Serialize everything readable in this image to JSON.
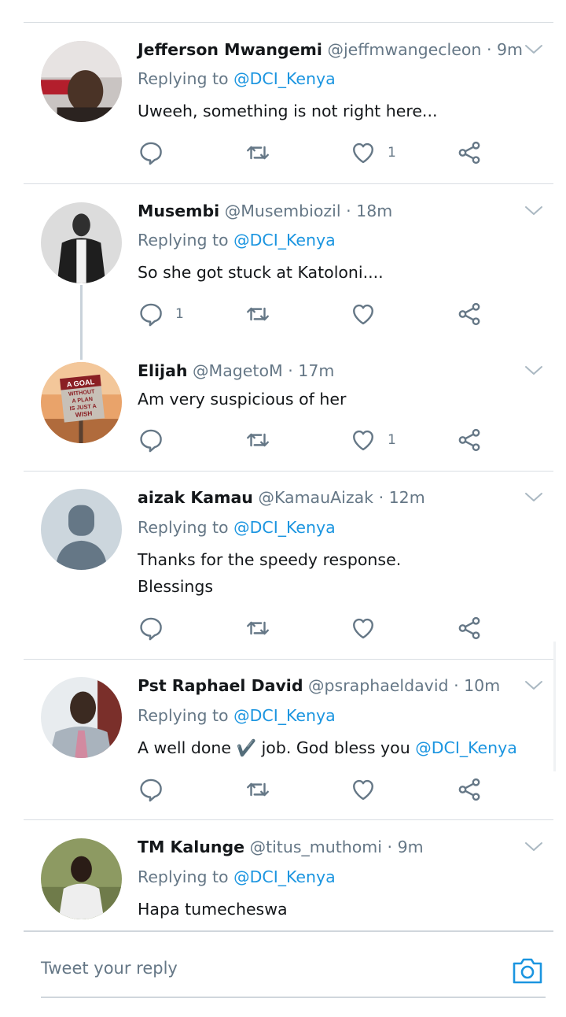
{
  "compose": {
    "placeholder": "Tweet your reply"
  },
  "colors": {
    "link": "#1b95e0",
    "muted": "#657786",
    "text": "#14171a",
    "separator": "#d9dee3"
  },
  "tweets": [
    {
      "name": "Jefferson Mwangemi",
      "handle": "@jeffmwangecleon",
      "dot": "·",
      "time": "9m",
      "replying_prefix": "Replying to",
      "replying_to": "@DCI_Kenya",
      "text": "Uweeh, something is not right here...",
      "reply_count": "",
      "retweet_count": "",
      "like_count": "1"
    },
    {
      "name": "Musembi",
      "handle": "@Musembiozil",
      "dot": "·",
      "time": "18m",
      "replying_prefix": "Replying to",
      "replying_to": "@DCI_Kenya",
      "text": "So she got stuck at Katoloni....",
      "reply_count": "1",
      "retweet_count": "",
      "like_count": ""
    },
    {
      "name": "Elijah",
      "handle": "@MagetoM",
      "dot": "·",
      "time": "17m",
      "text": "Am very suspicious of her",
      "avatar_sign": [
        "A GOAL",
        "WITHOUT",
        "A PLAN",
        "IS JUST A",
        "WISH"
      ],
      "reply_count": "",
      "retweet_count": "",
      "like_count": "1"
    },
    {
      "name": "aizak Kamau",
      "handle": "@KamauAizak",
      "dot": "·",
      "time": "12m",
      "replying_prefix": "Replying to",
      "replying_to": "@DCI_Kenya",
      "text_line1": "Thanks for the speedy response.",
      "text_line2": "Blessings",
      "reply_count": "",
      "retweet_count": "",
      "like_count": ""
    },
    {
      "name": "Pst Raphael David",
      "handle": "@psraphaeldavid",
      "dot": "·",
      "time": "10m",
      "replying_prefix": "Replying to",
      "replying_to": "@DCI_Kenya",
      "text_before": "A well done",
      "emoji": "✔️",
      "text_after": "job. God bless you",
      "text_mention": "@DCI_Kenya",
      "reply_count": "",
      "retweet_count": "",
      "like_count": ""
    },
    {
      "name": "TM Kalunge",
      "handle": "@titus_muthomi",
      "dot": "·",
      "time": "9m",
      "replying_prefix": "Replying to",
      "replying_to": "@DCI_Kenya",
      "text": "Hapa tumecheswa"
    }
  ]
}
